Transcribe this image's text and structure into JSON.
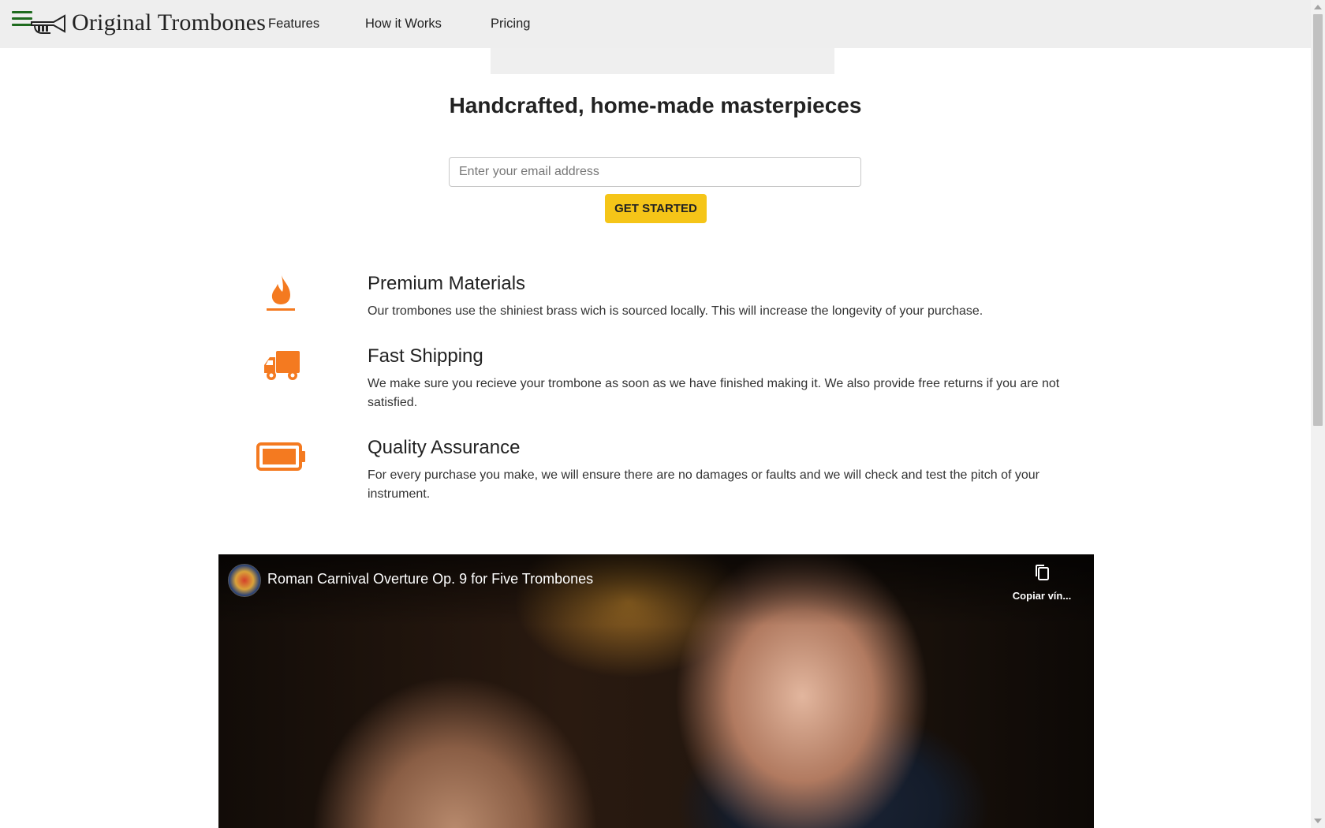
{
  "header": {
    "brand": "Original Trombones",
    "nav": [
      {
        "label": "Features"
      },
      {
        "label": "How it Works"
      },
      {
        "label": "Pricing"
      }
    ]
  },
  "hero": {
    "title": "Handcrafted, home-made masterpieces",
    "email_placeholder": "Enter your email address",
    "email_value": "",
    "cta_label": "GET STARTED"
  },
  "features": [
    {
      "icon": "fire-icon",
      "title": "Premium Materials",
      "text": "Our trombones use the shiniest brass wich is sourced locally. This will increase the longevity of your purchase."
    },
    {
      "icon": "truck-icon",
      "title": "Fast Shipping",
      "text": "We make sure you recieve your trombone as soon as we have finished making it. We also provide free returns if you are not satisfied."
    },
    {
      "icon": "battery-full-icon",
      "title": "Quality Assurance",
      "text": "For every purchase you make, we will ensure there are no damages or faults and we will check and test the pitch of your instrument."
    }
  ],
  "video": {
    "title": "Roman Carnival Overture Op. 9 for Five Trombones",
    "copy_link_label": "Copiar vín..."
  },
  "colors": {
    "accent_orange": "#f47a20",
    "cta_yellow": "#f5c518",
    "header_bg": "#eeeeee",
    "hamburger_green": "#1e6b1e"
  }
}
